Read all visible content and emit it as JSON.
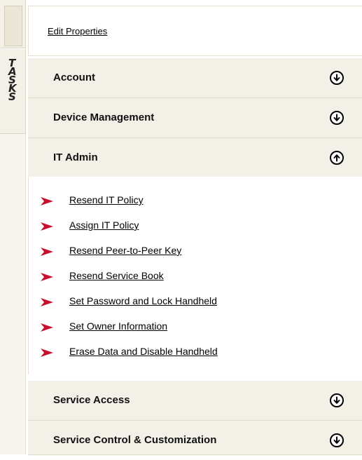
{
  "rail": {
    "tab_letters": [
      "T",
      "A",
      "S",
      "K",
      "S"
    ]
  },
  "edit_properties": "Edit Properties",
  "sections": {
    "account": "Account",
    "device_management": "Device Management",
    "it_admin": "IT Admin",
    "service_access": "Service Access",
    "service_control": "Service Control & Customization"
  },
  "it_admin_tasks": [
    "Resend IT Policy",
    "Assign IT Policy",
    "Resend Peer-to-Peer Key",
    "Resend Service Book",
    "Set Password and Lock Handheld",
    "Set Owner Information",
    "Erase Data and Disable Handheld"
  ],
  "icons": {
    "expand": "arrow-down-circle-icon",
    "collapse": "arrow-up-circle-icon",
    "task": "red-triangle-arrow-icon"
  },
  "colors": {
    "section_bg": "#f3f0e8",
    "task_arrow": "#c8102e"
  }
}
